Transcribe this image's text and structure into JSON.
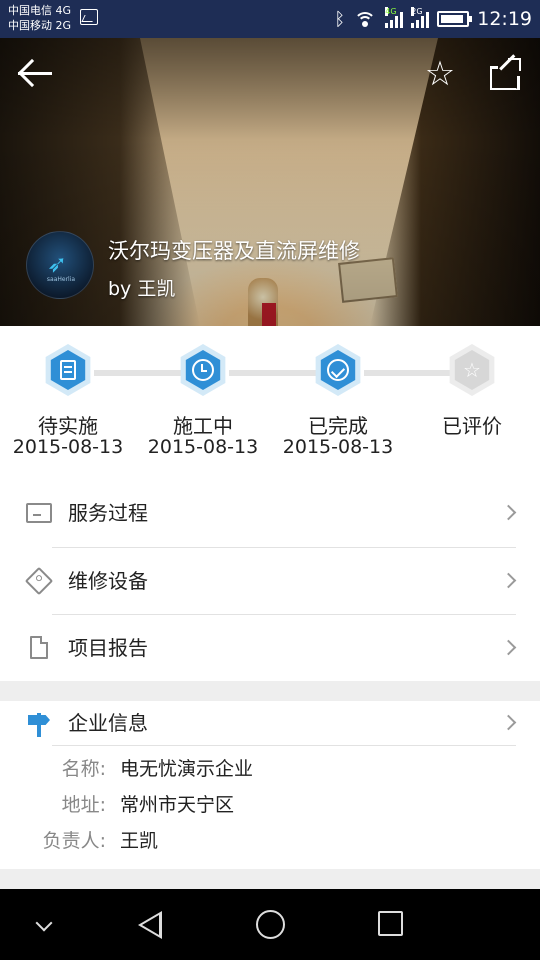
{
  "status_bar": {
    "carrier1": "中国电信 4G",
    "carrier2": "中国移动 2G",
    "net1": "4G",
    "net2": "2G",
    "time": "12:19"
  },
  "hero": {
    "title": "沃尔玛变压器及直流屏维修",
    "author": "by 王凯",
    "avatar_text": "saaHerlia",
    "icons": [
      "back-arrow-icon",
      "star-outline-icon",
      "share-icon"
    ]
  },
  "progress": {
    "accent_color": "#2f8fd6",
    "steps": [
      {
        "label": "待实施",
        "date": "2015-08-13",
        "done": true,
        "icon": "document-icon"
      },
      {
        "label": "施工中",
        "date": "2015-08-13",
        "done": true,
        "icon": "clock-icon"
      },
      {
        "label": "已完成",
        "date": "2015-08-13",
        "done": true,
        "icon": "check-circle-icon"
      },
      {
        "label": "已评价",
        "date": "",
        "done": false,
        "icon": "star-icon"
      }
    ]
  },
  "menu": {
    "items": [
      {
        "label": "服务过程",
        "icon": "process-icon"
      },
      {
        "label": "维修设备",
        "icon": "tag-icon"
      },
      {
        "label": "项目报告",
        "icon": "file-icon"
      }
    ]
  },
  "company": {
    "title": "企业信息",
    "fields": [
      {
        "key": "名称:",
        "value": "电无忧演示企业"
      },
      {
        "key": "地址:",
        "value": "常州市天宁区"
      },
      {
        "key": "负责人:",
        "value": "王凯"
      }
    ]
  }
}
